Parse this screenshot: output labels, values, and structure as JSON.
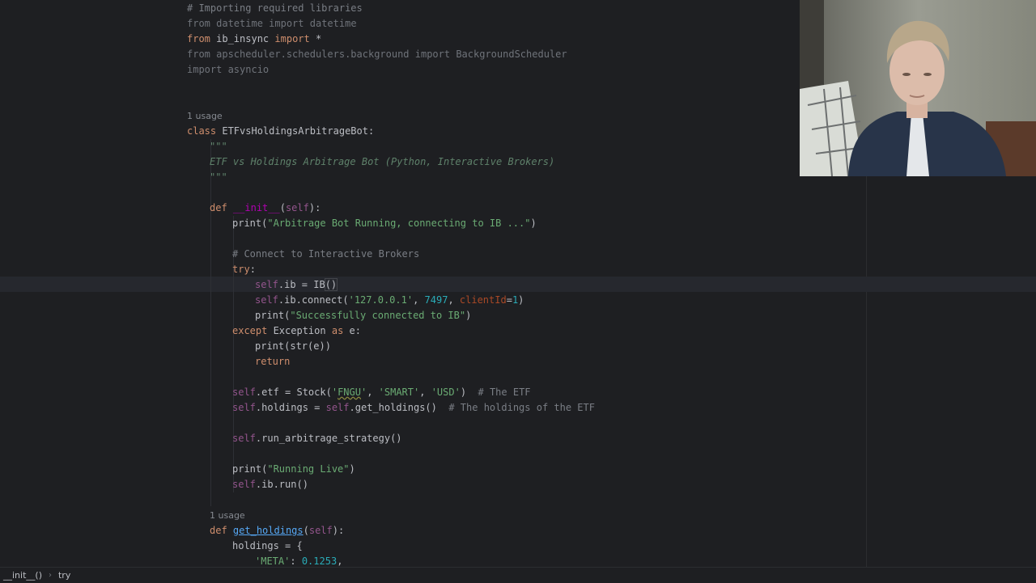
{
  "code": {
    "comment_import": "# Importing required libraries",
    "imp1_from": "from",
    "imp1_mod": " datetime ",
    "imp1_import": "import",
    "imp1_name": " datetime",
    "imp2_from": "from",
    "imp2_mod": " ib_insync ",
    "imp2_import": "import",
    "imp2_name": " *",
    "imp3": "from apscheduler.schedulers.background import BackgroundScheduler",
    "imp4": "import asyncio",
    "usage1": "1 usage",
    "class_kw": "class",
    "class_name": " ETFvsHoldingsArbitrageBot:",
    "doc_open": "\"\"\"",
    "doc_text": "ETF vs Holdings Arbitrage Bot (Python, Interactive Brokers)",
    "doc_close": "\"\"\"",
    "def_kw": "def",
    "init_name": "__init__",
    "init_self": "self",
    "print1_fn": "print(",
    "print1_str": "\"Arbitrage Bot Running, connecting to IB ...\"",
    "close_paren": ")",
    "comment_connect": "# Connect to Interactive Brokers",
    "try_kw": "try",
    "self_kw": "self",
    "ib_assign": ".ib = IB",
    "ib_paren": "()",
    "connect_call": ".ib.connect(",
    "connect_host": "'127.0.0.1'",
    "comma_sp": ", ",
    "connect_port": "7497",
    "client_param": "clientId",
    "equals": "=",
    "client_val": "1",
    "print2_str": "\"Successfully connected to IB\"",
    "except_kw": "except",
    "exception_name": " Exception ",
    "as_kw": "as",
    "e_colon": " e:",
    "print_str_e": "print(str(e))",
    "return_kw": "return",
    "etf_assign": ".etf = Stock(",
    "etf_q1": "'",
    "etf_symbol": "FNGU",
    "etf_q2": "'",
    "etf_smart": "'SMART'",
    "etf_usd": "'USD'",
    "etf_comment": "# The ETF",
    "holdings_assign": ".holdings = ",
    "holdings_call": ".get_holdings()",
    "holdings_comment": "# The holdings of the ETF",
    "run_strategy": ".run_arbitrage_strategy()",
    "print3_str": "\"Running Live\"",
    "ib_run": ".ib.run()",
    "usage2": "1 usage",
    "get_holdings_name": "get_holdings",
    "holdings_open": "holdings = {",
    "meta_key": "'META'",
    "meta_val": "0.1253",
    "colon": ":",
    "open_paren": "(",
    "close_paren_colon": "):"
  },
  "status": {
    "crumb1": "__init__()",
    "crumb_sep": "›",
    "crumb2": "try"
  },
  "colors": {
    "background": "#1e1f22",
    "keyword": "#cf8e6d",
    "string": "#6aab73",
    "number": "#2aacb8",
    "comment": "#7a7e85",
    "self": "#94558d",
    "function": "#56a8f5"
  }
}
